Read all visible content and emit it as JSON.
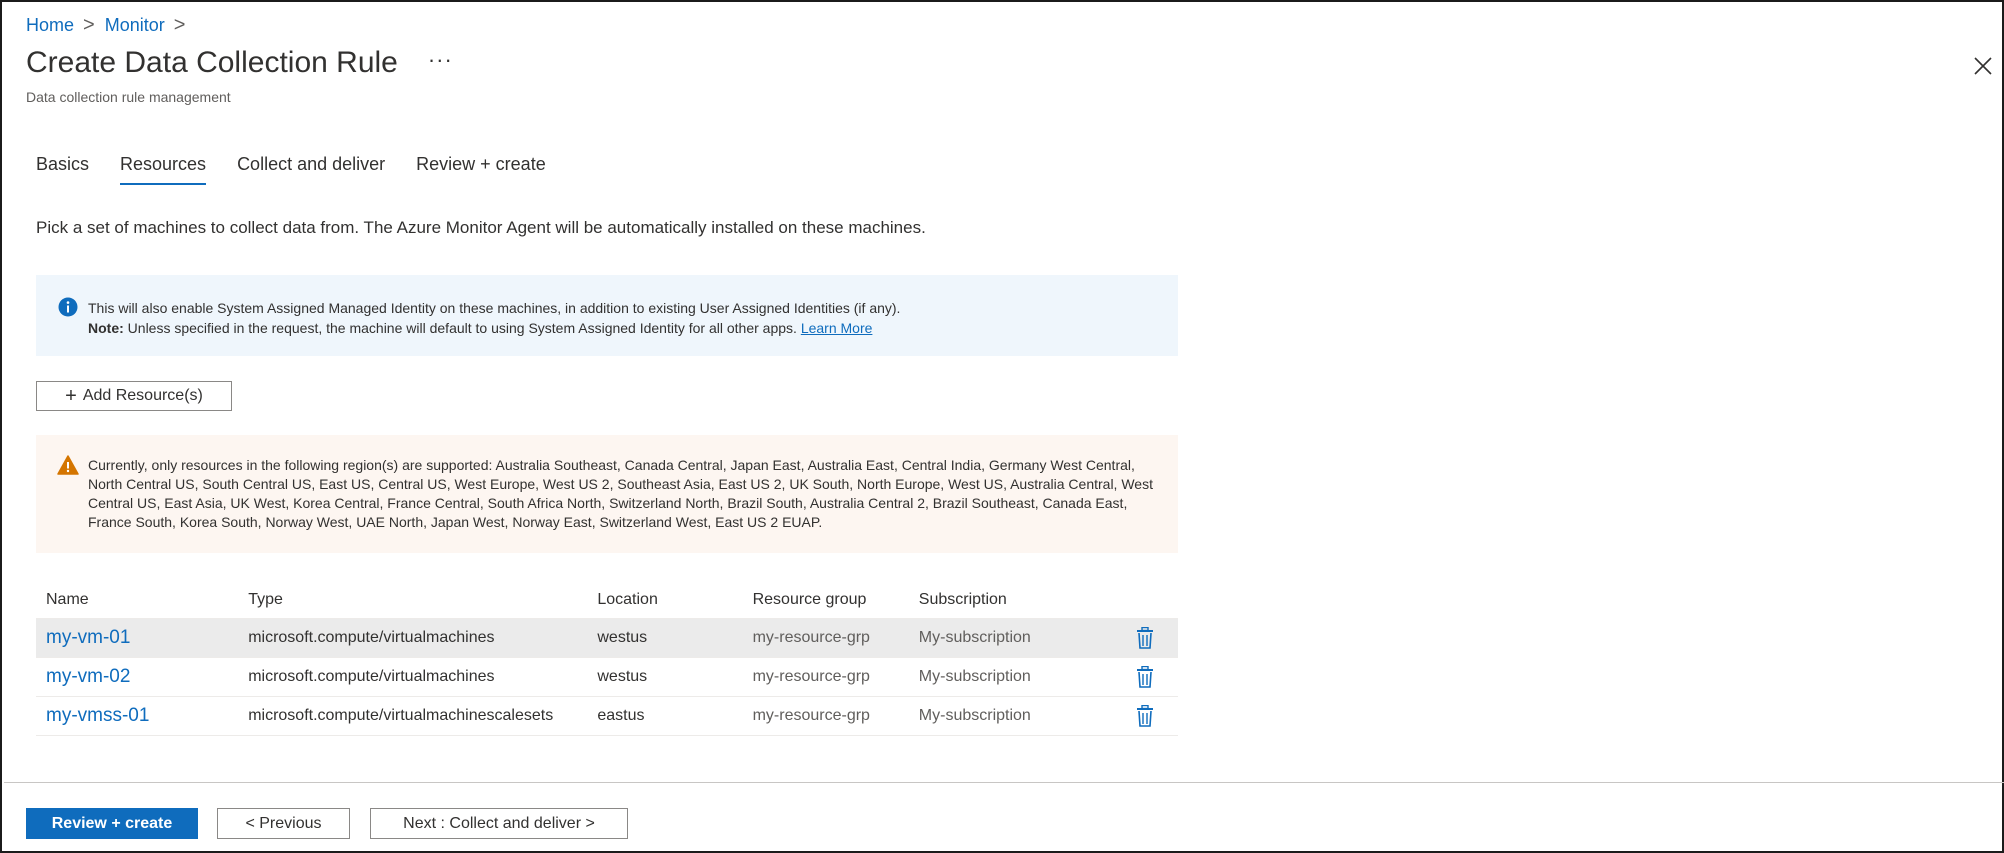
{
  "breadcrumb": {
    "home": "Home",
    "monitor": "Monitor",
    "sep": ">"
  },
  "header": {
    "title": "Create Data Collection Rule",
    "more": "···",
    "subtitle": "Data collection rule management"
  },
  "tabs": [
    {
      "label": "Basics",
      "active": false
    },
    {
      "label": "Resources",
      "active": true
    },
    {
      "label": "Collect and deliver",
      "active": false
    },
    {
      "label": "Review + create",
      "active": false
    }
  ],
  "description": "Pick a set of machines to collect data from. The Azure Monitor Agent will be automatically installed on these machines.",
  "info": {
    "line1": "This will also enable System Assigned Managed Identity on these machines, in addition to existing User Assigned Identities (if any).",
    "note_label": "Note:",
    "note_text": " Unless specified in the request, the machine will default to using System Assigned Identity for all other apps. ",
    "learn_more": "Learn More"
  },
  "add_resource": {
    "plus": "+",
    "label": "Add Resource(s)"
  },
  "warning": {
    "text": "Currently, only resources in the following region(s) are supported: Australia Southeast, Canada Central, Japan East, Australia East, Central India, Germany West Central, North Central US, South Central US, East US, Central US, West Europe, West US 2, Southeast Asia, East US 2, UK South, North Europe, West US, Australia Central, West Central US, East Asia, UK West, Korea Central, France Central, South Africa North, Switzerland North, Brazil South, Australia Central 2, Brazil Southeast, Canada East, France South, Korea South, Norway West, UAE North, Japan West, Norway East, Switzerland West, East US 2 EUAP."
  },
  "table": {
    "headers": {
      "name": "Name",
      "type": "Type",
      "location": "Location",
      "resource_group": "Resource group",
      "subscription": "Subscription"
    },
    "rows": [
      {
        "name": "my-vm-01",
        "type": "microsoft.compute/virtualmachines",
        "location": "westus",
        "resource_group": "my-resource-grp",
        "subscription": "My-subscription"
      },
      {
        "name": "my-vm-02",
        "type": "microsoft.compute/virtualmachines",
        "location": "westus",
        "resource_group": "my-resource-grp",
        "subscription": "My-subscription"
      },
      {
        "name": "my-vmss-01",
        "type": "microsoft.compute/virtualmachinescalesets",
        "location": "eastus",
        "resource_group": "my-resource-grp",
        "subscription": "My-subscription"
      }
    ]
  },
  "footer": {
    "review_create": "Review + create",
    "previous": "< Previous",
    "next": "Next : Collect and deliver >"
  },
  "colors": {
    "accent": "#0f6cbd",
    "info_bg": "#eff6fc",
    "warning_bg": "#fdf6f1",
    "warning_icon": "#d47500"
  },
  "icons": {
    "info": "info-circle-icon",
    "warning": "warning-triangle-icon",
    "delete": "trash-icon",
    "close": "close-icon",
    "chevron": "chevron-right-icon"
  }
}
